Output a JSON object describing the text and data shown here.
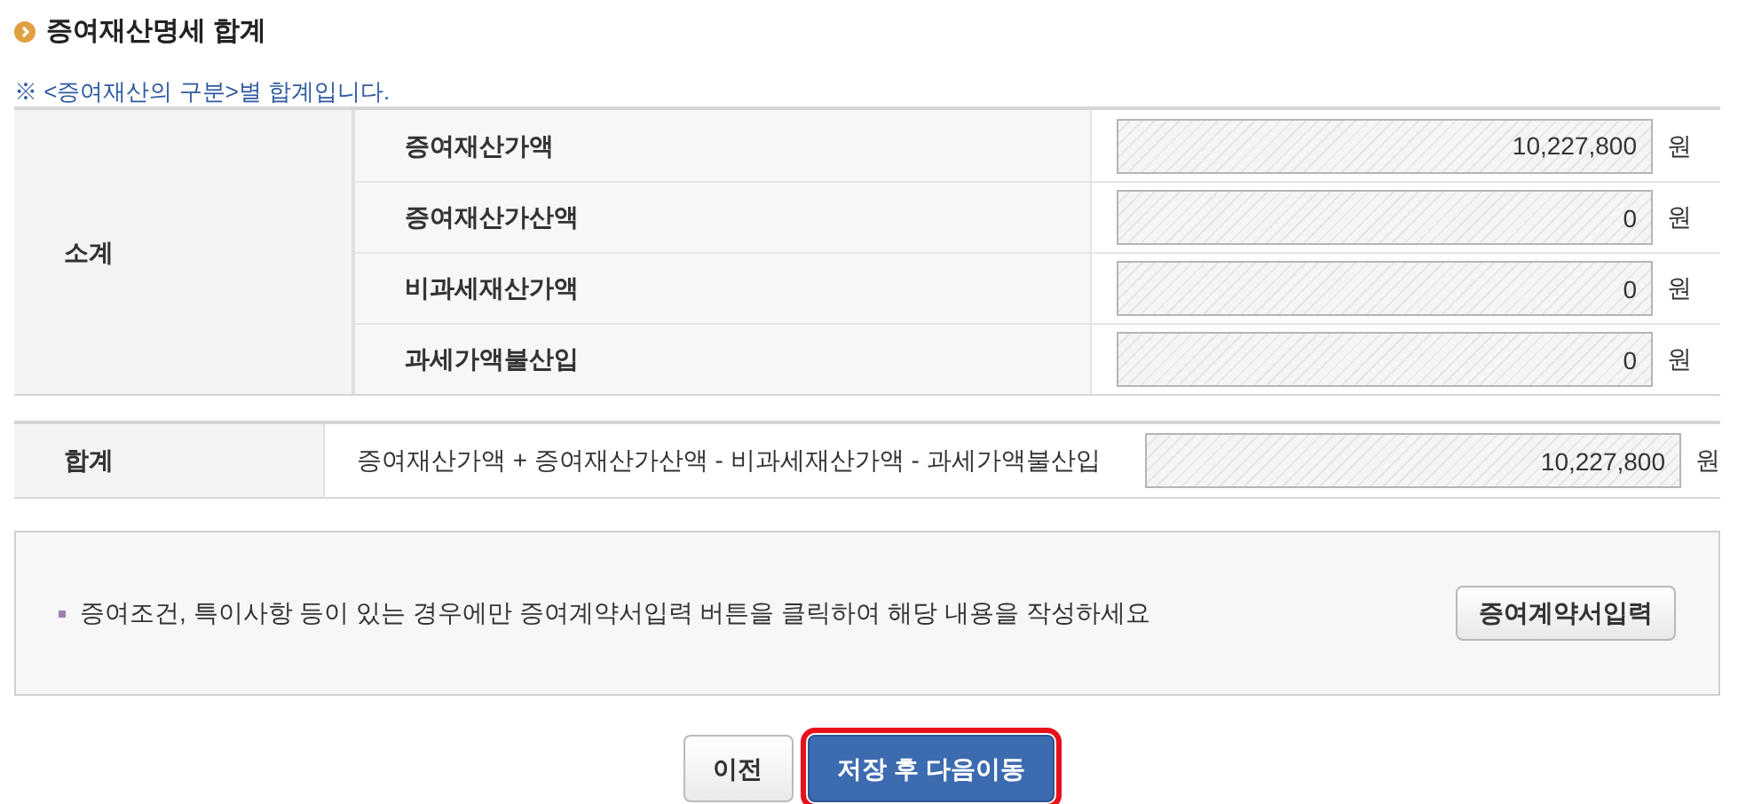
{
  "section_title": "증여재산명세 합계",
  "note": "※ <증여재산의 구분>별 합계입니다.",
  "subtotal": {
    "label": "소계",
    "rows": [
      {
        "label": "증여재산가액",
        "value": "10,227,800",
        "unit": "원"
      },
      {
        "label": "증여재산가산액",
        "value": "0",
        "unit": "원"
      },
      {
        "label": "비과세재산가액",
        "value": "0",
        "unit": "원"
      },
      {
        "label": "과세가액불산입",
        "value": "0",
        "unit": "원"
      }
    ]
  },
  "total": {
    "label": "합계",
    "formula": "증여재산가액 + 증여재산가산액 - 비과세재산가액 - 과세가액불산입",
    "value": "10,227,800",
    "unit": "원"
  },
  "info_box": {
    "text": "증여조건, 특이사항 등이 있는 경우에만 증여계약서입력 버튼을 클릭하여 해당 내용을 작성하세요",
    "button": "증여계약서입력"
  },
  "buttons": [
    {
      "label": "이전",
      "kind": "secondary",
      "highlighted": false
    },
    {
      "label": "저장 후 다음이동",
      "kind": "primary",
      "highlighted": true
    }
  ]
}
